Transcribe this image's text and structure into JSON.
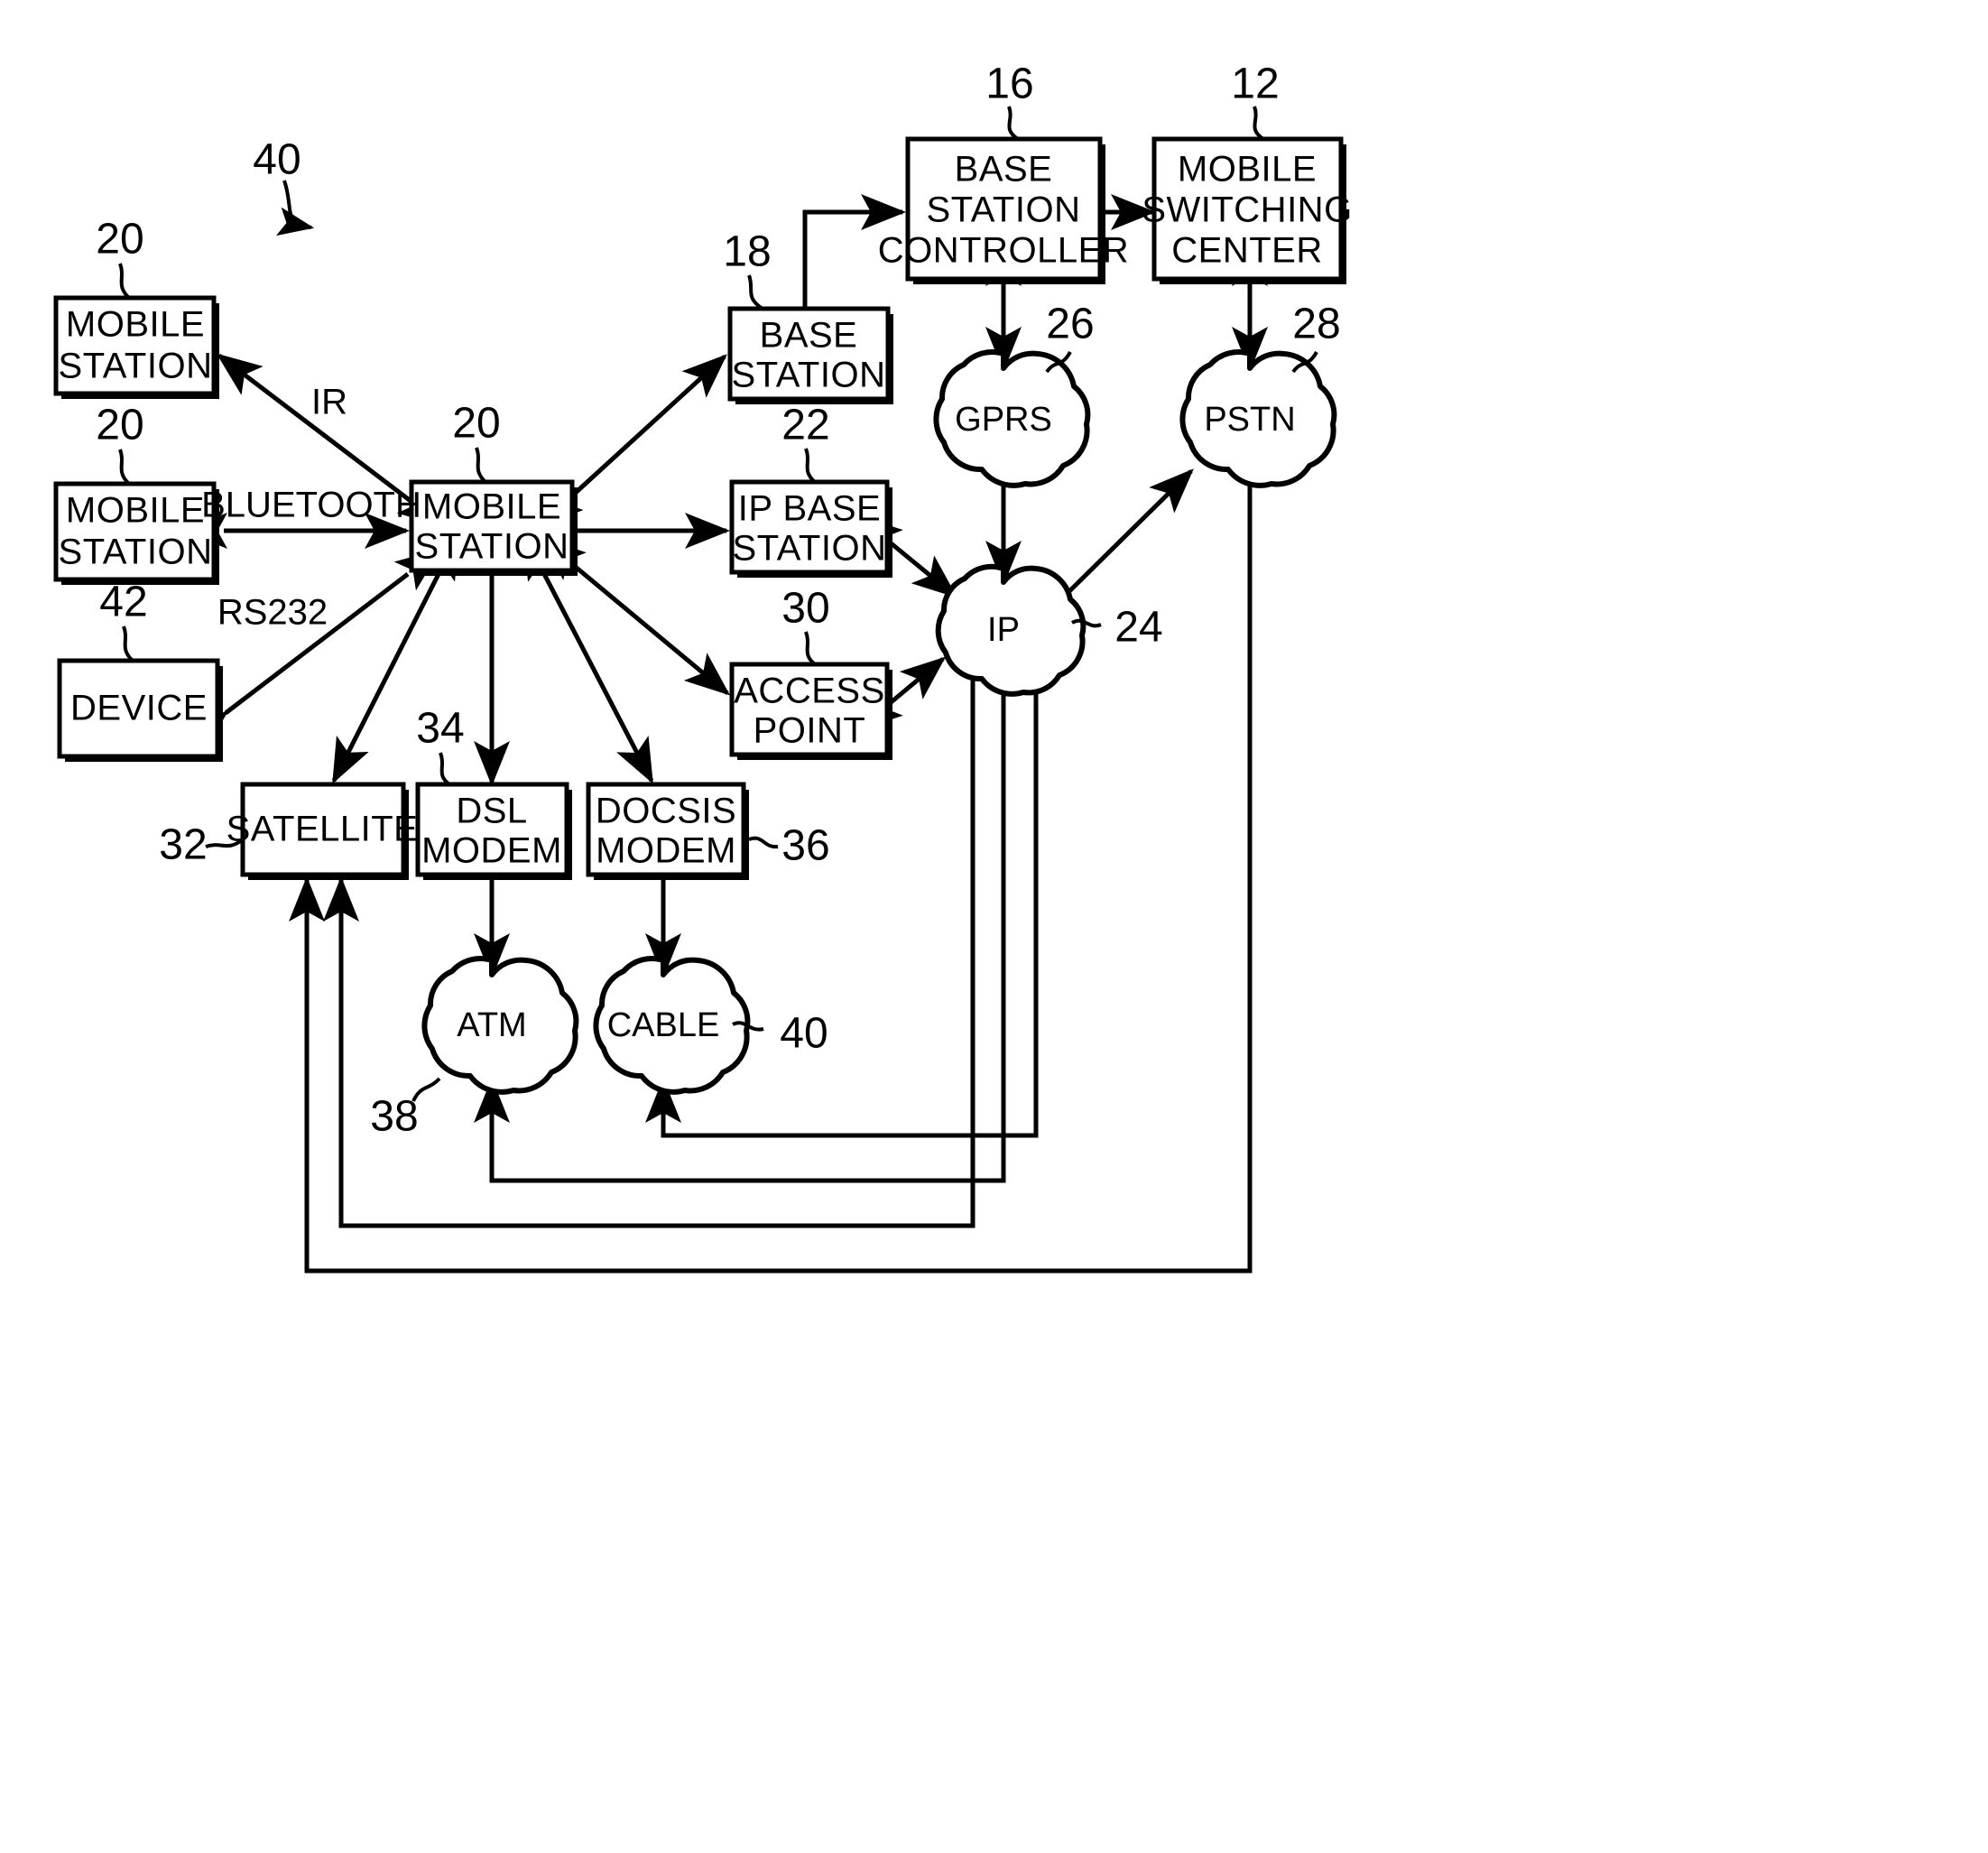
{
  "figure": {
    "type": "patent-network-diagram",
    "reference_numerals_visible": [
      "40",
      "20",
      "20",
      "20",
      "42",
      "18",
      "16",
      "12",
      "26",
      "28",
      "22",
      "30",
      "24",
      "32",
      "34",
      "36",
      "38",
      "40"
    ]
  },
  "nodes": {
    "mobile_station_top": {
      "label_line1": "MOBILE",
      "label_line2": "STATION",
      "ref": "20"
    },
    "mobile_station_mid": {
      "label_line1": "MOBILE",
      "label_line2": "STATION",
      "ref": "20"
    },
    "mobile_station_center": {
      "label_line1": "MOBILE",
      "label_line2": "STATION",
      "ref": "20"
    },
    "device": {
      "label_line1": "DEVICE",
      "label_line2": "",
      "ref": "42"
    },
    "base_station": {
      "label_line1": "BASE",
      "label_line2": "STATION",
      "ref": "18"
    },
    "base_station_controller": {
      "label_line1": "BASE",
      "label_line2": "STATION",
      "label_line3": "CONTROLLER",
      "ref": "16"
    },
    "mobile_switching_center": {
      "label_line1": "MOBILE",
      "label_line2": "SWITCHING",
      "label_line3": "CENTER",
      "ref": "12"
    },
    "ip_base_station": {
      "label_line1": "IP  BASE",
      "label_line2": "STATION",
      "ref": "22"
    },
    "access_point": {
      "label_line1": "ACCESS",
      "label_line2": "POINT",
      "ref": "30"
    },
    "satellite": {
      "label_line1": "SATELLITE",
      "label_line2": "",
      "ref": "32"
    },
    "dsl_modem": {
      "label_line1": "DSL",
      "label_line2": "MODEM",
      "ref": "34"
    },
    "docsis_modem": {
      "label_line1": "DOCSIS",
      "label_line2": "MODEM",
      "ref": "36"
    }
  },
  "clouds": {
    "gprs": {
      "label": "GPRS",
      "ref": "26"
    },
    "pstn": {
      "label": "PSTN",
      "ref": "28"
    },
    "ip": {
      "label": "IP",
      "ref": "24"
    },
    "atm": {
      "label": "ATM",
      "ref": "38"
    },
    "cable": {
      "label": "CABLE",
      "ref": "40"
    }
  },
  "edge_labels": {
    "ir": "IR",
    "bluetooth": "BLUETOOTH",
    "rs232": "RS232"
  },
  "figure_ref": {
    "label": "40"
  },
  "colors": {
    "ink": "#000000",
    "paper": "#ffffff"
  }
}
